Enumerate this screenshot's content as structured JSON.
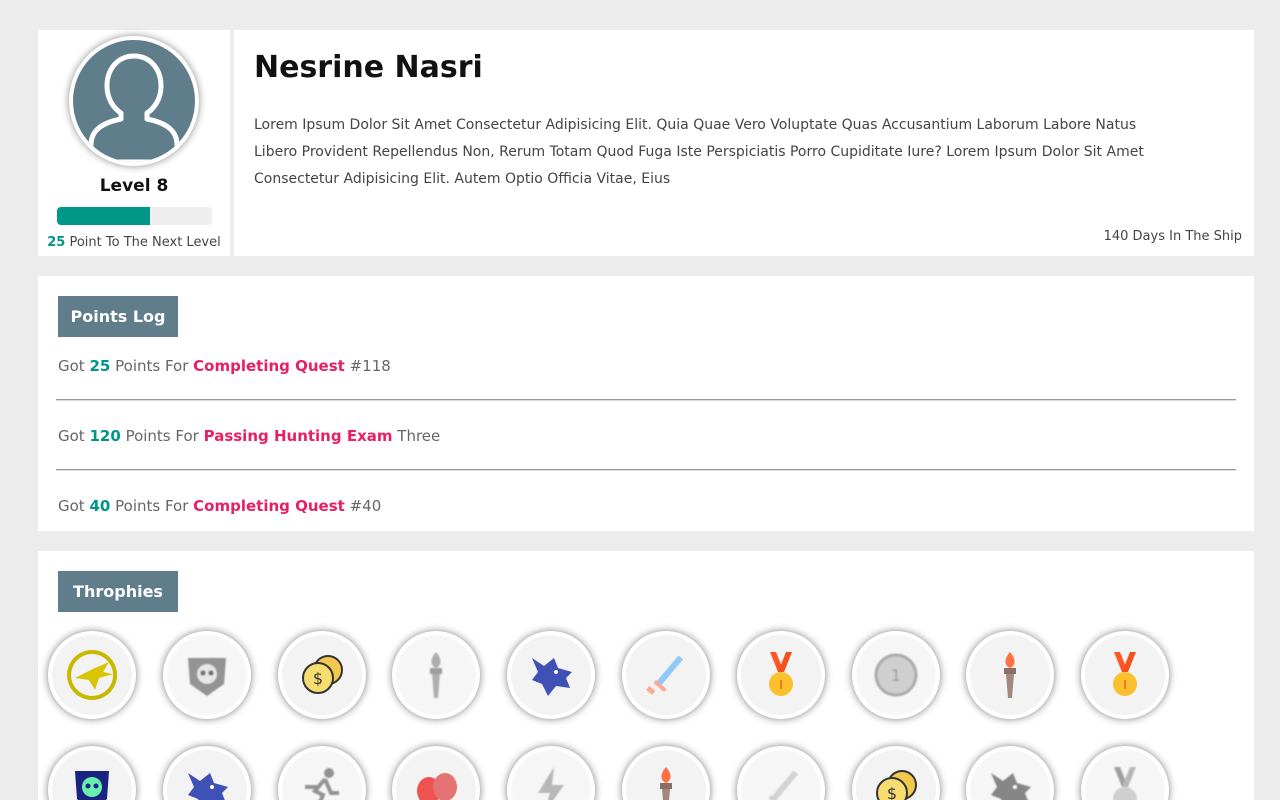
{
  "profile": {
    "level": "Level 8",
    "level_progress": 0.6,
    "next_level_points": "25",
    "next_level_text": "Point To The Next Level",
    "name": "Nesrine Nasri",
    "bio": "Lorem Ipsum Dolor Sit Amet Consectetur Adipisicing Elit. Quia Quae Vero Voluptate Quas Accusantium Laborum Labore Natus Libero Provident Repellendus Non, Rerum Totam Quod Fuga Iste Perspiciatis Porro Cupiditate Iure? Lorem Ipsum Dolor Sit Amet Consectetur Adipisicing Elit. Autem Optio Officia Vitae, Eius",
    "days_in_ship": "140 Days In The Ship",
    "avatar_icon": "user-silhouette-icon"
  },
  "points_log": {
    "title": "Points Log",
    "entries": [
      {
        "prefix": "Got",
        "points": "25",
        "middle": "Points For",
        "action": "Completing Quest",
        "suffix": "#118"
      },
      {
        "prefix": "Got",
        "points": "120",
        "middle": "Points For",
        "action": "Passing Hunting Exam",
        "suffix": "Three"
      },
      {
        "prefix": "Got",
        "points": "40",
        "middle": "Points For",
        "action": "Completing Quest",
        "suffix": "#40"
      }
    ]
  },
  "trophies": {
    "title": "Throphies",
    "items": [
      {
        "icon": "hawk-emblem-icon",
        "locked": false
      },
      {
        "icon": "skull-shield-icon",
        "locked": true
      },
      {
        "icon": "coins-icon",
        "locked": false
      },
      {
        "icon": "torch-icon",
        "locked": true
      },
      {
        "icon": "wolf-head-icon",
        "locked": false
      },
      {
        "icon": "sword-icon",
        "locked": false
      },
      {
        "icon": "gold-medal-icon",
        "locked": false
      },
      {
        "icon": "silver-coin-icon",
        "locked": true
      },
      {
        "icon": "torch-icon",
        "locked": false
      },
      {
        "icon": "gold-medal-icon",
        "locked": false
      },
      {
        "icon": "skull-trophy-icon",
        "locked": false
      },
      {
        "icon": "wolf-head-icon",
        "locked": false
      },
      {
        "icon": "running-man-icon",
        "locked": true
      },
      {
        "icon": "boxing-gloves-icon",
        "locked": false
      },
      {
        "icon": "lightning-icon",
        "locked": true
      },
      {
        "icon": "torch-icon",
        "locked": false
      },
      {
        "icon": "sword-icon",
        "locked": true
      },
      {
        "icon": "coins-icon",
        "locked": false
      },
      {
        "icon": "wolf-head-icon",
        "locked": true
      },
      {
        "icon": "silver-medal-icon",
        "locked": true
      }
    ]
  },
  "colors": {
    "accent": "#009688",
    "highlight": "#e91e63",
    "header_bg": "#607d8b"
  }
}
